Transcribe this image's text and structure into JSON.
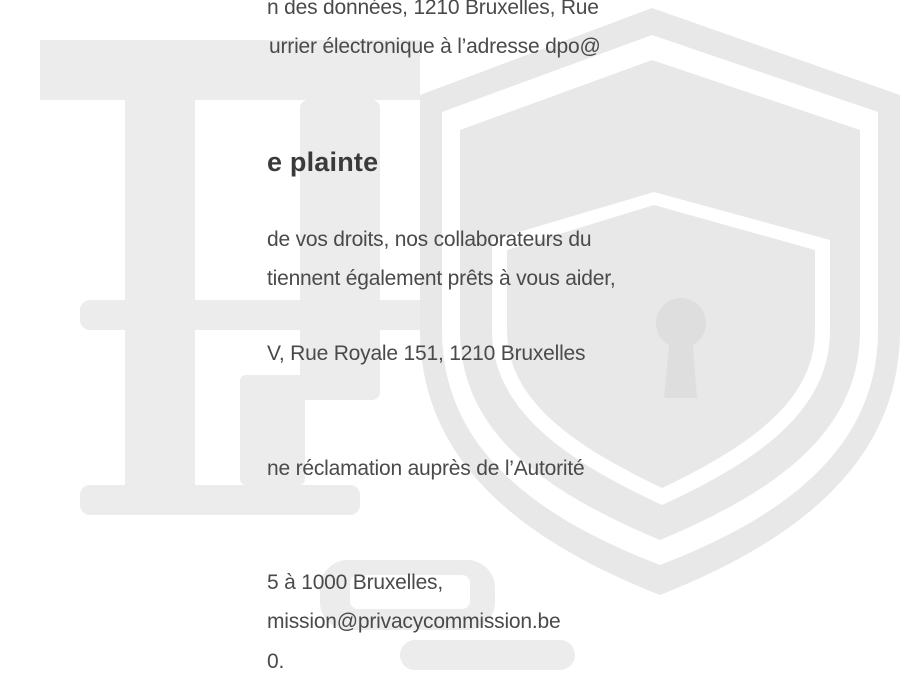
{
  "document": {
    "paragraph_1": {
      "line_1": "n des données, 1210 Bruxelles, Rue",
      "line_2": "urrier électronique à l’adresse dpo@"
    },
    "section_heading": "e plainte",
    "paragraph_2": {
      "line_1": "de vos droits, nos collaborateurs du",
      "line_2": "tiennent également prêts à vous aider,"
    },
    "address_line": "V, Rue Royale 151, 1210 Bruxelles",
    "paragraph_3": {
      "line_1": "ne réclamation auprès de l’Autorité"
    },
    "authority": {
      "address": "5 à 1000 Bruxelles,",
      "email": "mission@privacycommission.be",
      "tail": "0."
    }
  },
  "background": {
    "shield_color": "#e6e6e6",
    "document_outline_color": "#ececec",
    "keyhole_color": "#dedede"
  }
}
